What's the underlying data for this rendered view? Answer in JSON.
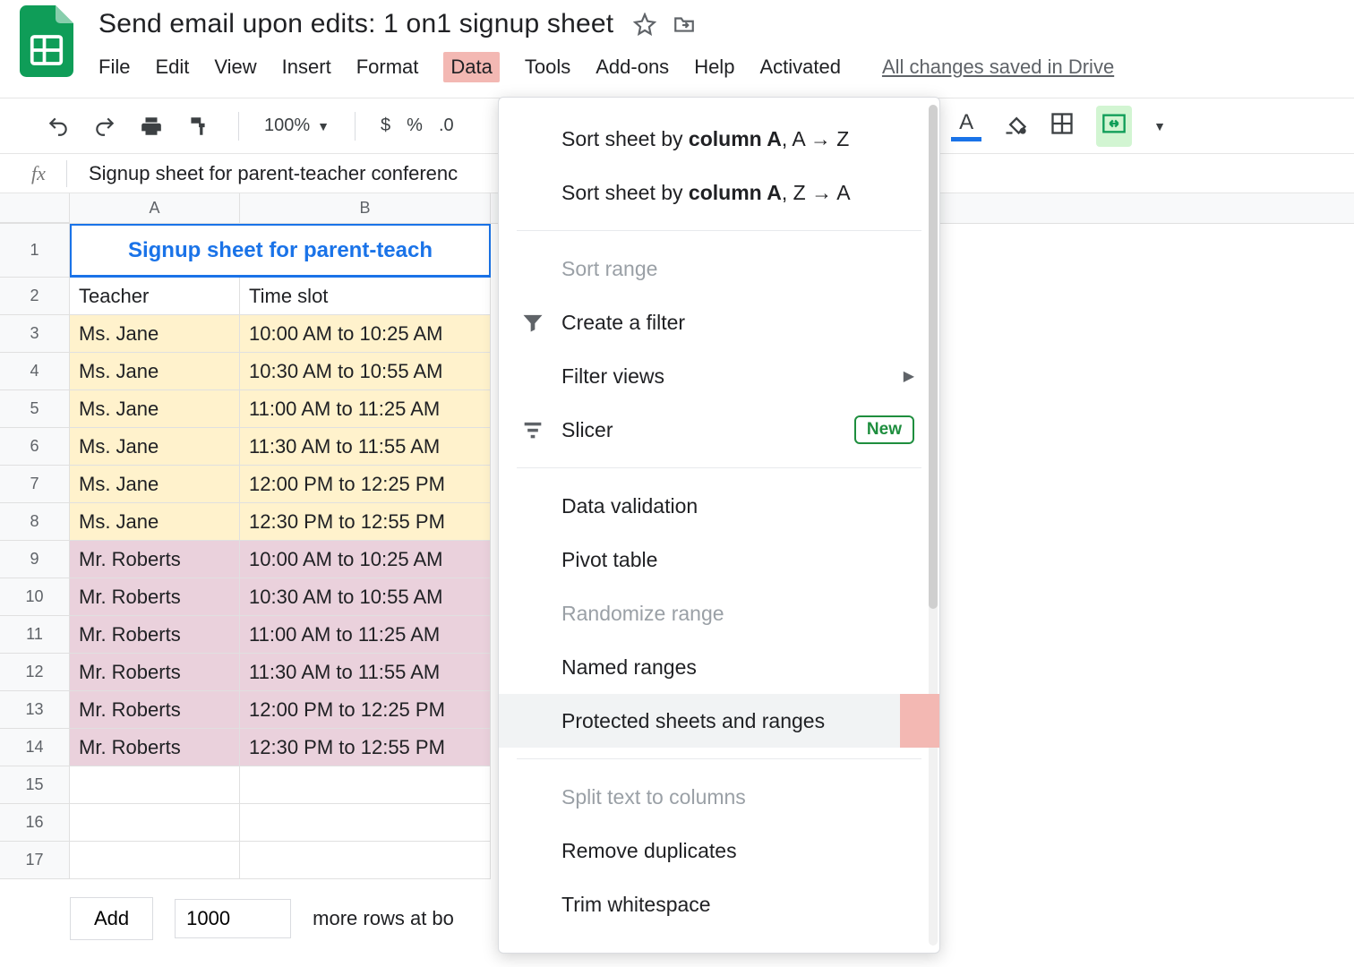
{
  "doc": {
    "title": "Send email upon edits: 1 on1 signup sheet"
  },
  "menu": {
    "items": [
      "File",
      "Edit",
      "View",
      "Insert",
      "Format",
      "Data",
      "Tools",
      "Add-ons",
      "Help",
      "Activated"
    ],
    "active_index": 5,
    "save_status": "All changes saved in Drive"
  },
  "toolbar": {
    "zoom": "100%",
    "currency": "$",
    "percent": "%",
    "decimals_label": ".0"
  },
  "formula_bar": {
    "fx": "fx",
    "value": "Signup sheet for parent-teacher conferenc"
  },
  "columns": [
    "A",
    "B"
  ],
  "sheet_title_cell": "Signup sheet for parent-teach",
  "headers": {
    "teacher": "Teacher",
    "timeslot": "Time slot"
  },
  "rows": [
    {
      "n": 1
    },
    {
      "n": 2
    },
    {
      "n": 3,
      "teacher": "Ms. Jane",
      "slot": "10:00 AM to 10:25 AM",
      "bg": "yellow"
    },
    {
      "n": 4,
      "teacher": "Ms. Jane",
      "slot": "10:30 AM to 10:55 AM",
      "bg": "yellow"
    },
    {
      "n": 5,
      "teacher": "Ms. Jane",
      "slot": "11:00 AM to 11:25 AM",
      "bg": "yellow"
    },
    {
      "n": 6,
      "teacher": "Ms. Jane",
      "slot": "11:30 AM to 11:55 AM",
      "bg": "yellow"
    },
    {
      "n": 7,
      "teacher": "Ms. Jane",
      "slot": "12:00 PM to 12:25 PM",
      "bg": "yellow"
    },
    {
      "n": 8,
      "teacher": "Ms. Jane",
      "slot": "12:30 PM to 12:55 PM",
      "bg": "yellow"
    },
    {
      "n": 9,
      "teacher": "Mr. Roberts",
      "slot": "10:00 AM to 10:25 AM",
      "bg": "pink"
    },
    {
      "n": 10,
      "teacher": "Mr. Roberts",
      "slot": "10:30 AM to 10:55 AM",
      "bg": "pink"
    },
    {
      "n": 11,
      "teacher": "Mr. Roberts",
      "slot": "11:00 AM to 11:25 AM",
      "bg": "pink"
    },
    {
      "n": 12,
      "teacher": "Mr. Roberts",
      "slot": "11:30 AM to 11:55 AM",
      "bg": "pink"
    },
    {
      "n": 13,
      "teacher": "Mr. Roberts",
      "slot": "12:00 PM to 12:25 PM",
      "bg": "pink"
    },
    {
      "n": 14,
      "teacher": "Mr. Roberts",
      "slot": "12:30 PM to 12:55 PM",
      "bg": "pink"
    },
    {
      "n": 15
    },
    {
      "n": 16
    },
    {
      "n": 17
    }
  ],
  "dropdown": {
    "sort_az_prefix": "Sort sheet by ",
    "sort_az_col": "column A",
    "sort_az_suffix": ", A → Z",
    "sort_za_prefix": "Sort sheet by ",
    "sort_za_col": "column A",
    "sort_za_suffix": ", Z → A",
    "sort_range": "Sort range",
    "create_filter": "Create a filter",
    "filter_views": "Filter views",
    "slicer": "Slicer",
    "slicer_badge": "New",
    "data_validation": "Data validation",
    "pivot_table": "Pivot table",
    "randomize": "Randomize range",
    "named_ranges": "Named ranges",
    "protected": "Protected sheets and ranges",
    "split_text": "Split text to columns",
    "remove_dupes": "Remove duplicates",
    "trim_ws": "Trim whitespace"
  },
  "footer": {
    "add_label": "Add",
    "rows_value": "1000",
    "more_rows_label": "more rows at bo"
  }
}
